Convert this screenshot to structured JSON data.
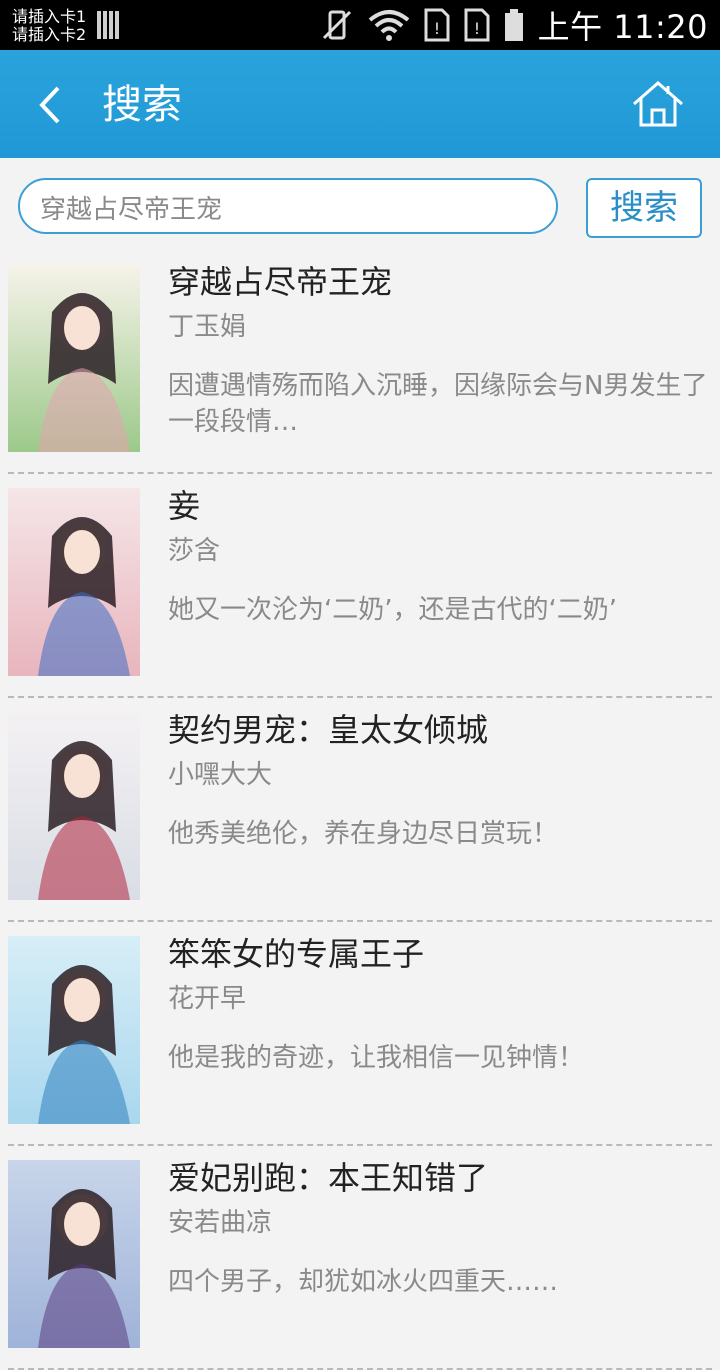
{
  "status_bar": {
    "sim1": "请插入卡1",
    "sim2": "请插入卡2",
    "time": "上午 11:20"
  },
  "header": {
    "title": "搜索"
  },
  "search": {
    "value": "穿越占尽帝王宠",
    "button_label": "搜索"
  },
  "books": [
    {
      "title": "穿越占尽帝王宠",
      "author": "丁玉娟",
      "description": "因遭遇情殇而陷入沉睡，因缘际会与N男发生了一段段情…",
      "cover_colors": [
        "#f7f3ea",
        "#9cc98a",
        "#e6a3b0"
      ]
    },
    {
      "title": "妾",
      "author": "莎含",
      "description": "她又一次沦为‘二奶’，还是古代的‘二奶’",
      "cover_colors": [
        "#f5e6e8",
        "#e8b5bd",
        "#3d6bc2"
      ]
    },
    {
      "title": "契约男宠：皇太女倾城",
      "author": "小嘿大大",
      "description": "他秀美绝伦，养在身边尽日赏玩！",
      "cover_colors": [
        "#f4f1f3",
        "#d9dde5",
        "#b0233a"
      ]
    },
    {
      "title": "笨笨女的专属王子",
      "author": "花开早",
      "description": "他是我的奇迹，让我相信一见钟情！",
      "cover_colors": [
        "#d7eef7",
        "#a9d7ee",
        "#2f7fc0"
      ]
    },
    {
      "title": "爱妃别跑：本王知错了",
      "author": "安若曲凉",
      "description": "四个男子，却犹如冰火四重天……",
      "cover_colors": [
        "#c8d5ea",
        "#9fb3d9",
        "#5a3c80"
      ]
    }
  ]
}
